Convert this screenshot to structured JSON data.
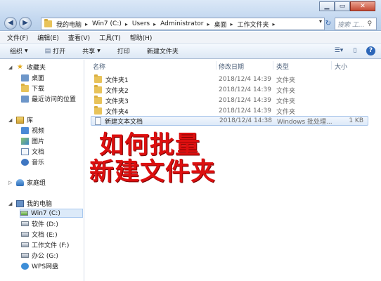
{
  "window": {
    "minimize_label": "▁",
    "maximize_label": "▭",
    "close_label": "✕"
  },
  "address_bar": {
    "breadcrumbs": [
      "我的电脑",
      "Win7 (C:)",
      "Users",
      "Administrator",
      "桌面",
      "工作文件夹"
    ],
    "search_placeholder": "搜索 工..."
  },
  "menu": {
    "items": [
      "文件(F)",
      "编辑(E)",
      "查看(V)",
      "工具(T)",
      "帮助(H)"
    ]
  },
  "toolbar": {
    "organize_label": "组织",
    "open_label": "打开",
    "share_label": "共享",
    "print_label": "打印",
    "new_folder_label": "新建文件夹"
  },
  "nav_pane": {
    "favorites": {
      "label": "收藏夹",
      "items": [
        "桌面",
        "下载",
        "最近访问的位置"
      ]
    },
    "libraries": {
      "label": "库",
      "items": [
        "视频",
        "图片",
        "文档",
        "音乐"
      ]
    },
    "homegroup_label": "家庭组",
    "computer": {
      "label": "我的电脑",
      "items": [
        "Win7 (C:)",
        "软件 (D:)",
        "文档 (E:)",
        "工作文件 (F:)",
        "办公 (G:)",
        "WPS网盘"
      ]
    }
  },
  "file_list": {
    "columns": {
      "name": "名称",
      "date": "修改日期",
      "type": "类型",
      "size": "大小"
    },
    "rows": [
      {
        "name": "文件夹1",
        "date": "2018/12/4 14:39",
        "type": "文件夹",
        "size": ""
      },
      {
        "name": "文件夹2",
        "date": "2018/12/4 14:39",
        "type": "文件夹",
        "size": ""
      },
      {
        "name": "文件夹3",
        "date": "2018/12/4 14:39",
        "type": "文件夹",
        "size": ""
      },
      {
        "name": "文件夹4",
        "date": "2018/12/4 14:39",
        "type": "文件夹",
        "size": ""
      },
      {
        "name": "新建文本文档",
        "date": "2018/12/4 14:38",
        "type": "Windows 批处理...",
        "size": "1 KB"
      }
    ]
  },
  "overlay": {
    "line1": "如何批量",
    "line2": "新建文件夹"
  },
  "colors": {
    "overlay_text": "#dc0f0f",
    "selection": "#dde9f8"
  }
}
